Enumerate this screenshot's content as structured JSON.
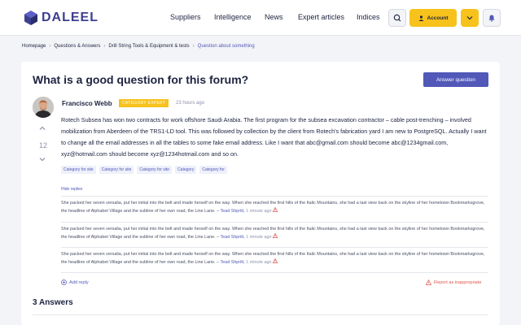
{
  "header": {
    "logo_text": "DALEEL",
    "nav": [
      "Suppliers",
      "Intelligence",
      "News",
      "Expert articles",
      "Indices"
    ],
    "account_label": "Account",
    "icons": [
      "search-icon",
      "user-icon",
      "chevron-down-icon",
      "bell-icon"
    ],
    "accent": "#f7c21b"
  },
  "breadcrumb": [
    "Homepage",
    "Questions & Answers",
    "Drill String Tools & Equipment & tests",
    "Question about something"
  ],
  "question": {
    "title": "What is a good question for this forum?",
    "answer_button": "Answer question",
    "author": "Francisco Webb",
    "badge": "CATEGORY EXPERT",
    "time": "23 hours ago",
    "votes": "12",
    "body": "Rotech Subsea has won two contracts for work offshore Saudi Arabia. The first program for the subsea excavation contractor – cable post-trenching – involved mobilization from Aberdeen of the TRS1-LD tool. This was followed by collection by the client from Rotech's fabrication yard I am new to PostgreSQL. Actually I want to change all the email addresses in all the tables to some fake email address. Like I want that abc@gmail.com should become abc@1234gmail.com, xyz@hotmail.com should become xyz@1234hotmail.com and so on.",
    "tags": [
      "Category for site",
      "Category for site",
      "Category for site",
      "Category",
      "Category for"
    ],
    "hide_replies": "Hide replies",
    "add_reply": "Add reply",
    "report": "Report as inappropriate"
  },
  "replies": [
    {
      "text": "She packed her seven versalia, put her initial into the belt and made herself on the way. When she reached the first hills of the Italic Mountains, she had a last view back on the skyline of her hometown Bookmarksgrove, the headline of Alphabet Village and the subline of her own road, the Line Lane.",
      "author": "Tead Shpritt,",
      "time": "1 minute ago"
    },
    {
      "text": "She packed her seven versalia, put her initial into the belt and made herself on the way. When she reached the first hills of the Italic Mountains, she had a last view back on the skyline of her hometown Bookmarksgrove, the headline of Alphabet Village and the subline of her own road, the Line Lane.",
      "author": "Tead Shpritt,",
      "time": "1 minute ago"
    },
    {
      "text": "She packed her seven versalia, put her initial into the belt and made herself on the way. When she reached the first hills of the Italic Mountains, she had a last view back on the skyline of her hometown Bookmarksgrove, the headline of Alphabet Village and the subline of her own road, the Line Lane.",
      "author": "Tead Shpritt,",
      "time": "1 minute ago"
    }
  ],
  "answers": {
    "heading": "3 Answers"
  }
}
